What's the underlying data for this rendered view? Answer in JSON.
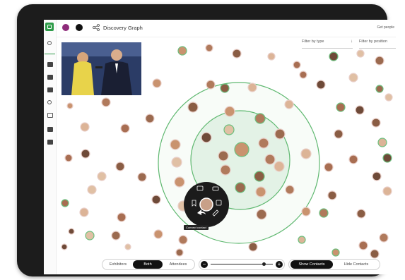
{
  "app": {
    "page_title": "Discovery Graph",
    "user_menu_label": "Get people"
  },
  "filters": {
    "type_label": "Filter by type",
    "position_label": "Filter by position"
  },
  "toggle": {
    "options": [
      "Exhibitors",
      "Both",
      "Attendees"
    ],
    "selected": "Both"
  },
  "zoom": {
    "minus": "−",
    "plus": "+",
    "level": 0.85
  },
  "contacts_toggle": {
    "show_label": "Show Contacts",
    "hide_label": "Hide Contacts",
    "selected": "Show Contacts"
  },
  "context_menu": {
    "tooltip": "Connect contact",
    "actions": [
      "chat-icon",
      "video-icon",
      "bookmark-icon",
      "share-icon",
      "calendar-icon",
      "edit-icon"
    ]
  },
  "colors": {
    "accent_green": "#3aa655",
    "ring_fill": "#e3f2e6",
    "avatar_border": "#e9cfc9",
    "dark_menu": "#1b1b1b"
  }
}
